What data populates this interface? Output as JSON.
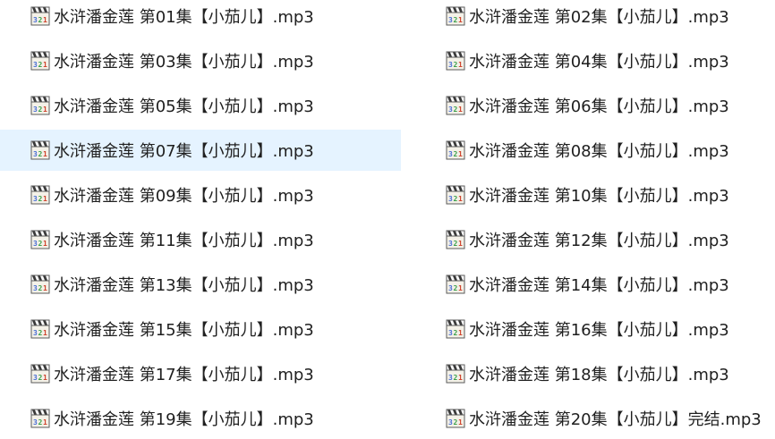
{
  "file_list": {
    "selected_index": 6,
    "icon": "media-player-audio-file-icon",
    "items": [
      {
        "name": "水浒潘金莲 第01集【小茄儿】.mp3"
      },
      {
        "name": "水浒潘金莲 第02集【小茄儿】.mp3"
      },
      {
        "name": "水浒潘金莲 第03集【小茄儿】.mp3"
      },
      {
        "name": "水浒潘金莲 第04集【小茄儿】.mp3"
      },
      {
        "name": "水浒潘金莲 第05集【小茄儿】.mp3"
      },
      {
        "name": "水浒潘金莲 第06集【小茄儿】.mp3"
      },
      {
        "name": "水浒潘金莲 第07集【小茄儿】.mp3"
      },
      {
        "name": "水浒潘金莲 第08集【小茄儿】.mp3"
      },
      {
        "name": "水浒潘金莲 第09集【小茄儿】.mp3"
      },
      {
        "name": "水浒潘金莲 第10集【小茄儿】.mp3"
      },
      {
        "name": "水浒潘金莲 第11集【小茄儿】.mp3"
      },
      {
        "name": "水浒潘金莲 第12集【小茄儿】.mp3"
      },
      {
        "name": "水浒潘金莲 第13集【小茄儿】.mp3"
      },
      {
        "name": "水浒潘金莲 第14集【小茄儿】.mp3"
      },
      {
        "name": "水浒潘金莲 第15集【小茄儿】.mp3"
      },
      {
        "name": "水浒潘金莲 第16集【小茄儿】.mp3"
      },
      {
        "name": "水浒潘金莲 第17集【小茄儿】.mp3"
      },
      {
        "name": "水浒潘金莲 第18集【小茄儿】.mp3"
      },
      {
        "name": "水浒潘金莲 第19集【小茄儿】.mp3"
      },
      {
        "name": "水浒潘金莲 第20集【小茄儿】完结.mp3"
      }
    ]
  }
}
